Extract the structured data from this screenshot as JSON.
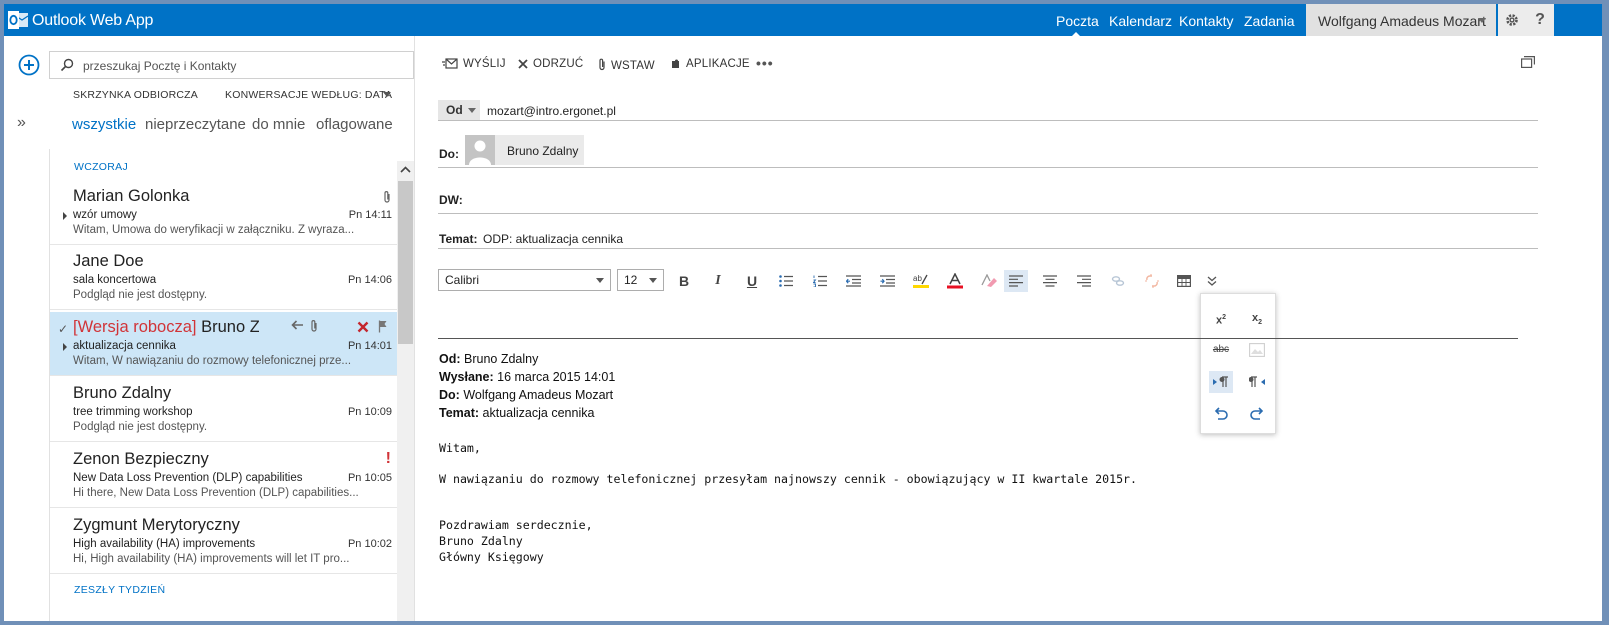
{
  "app": {
    "title": "Outlook Web App"
  },
  "nav": {
    "items": [
      "Poczta",
      "Kalendarz",
      "Kontakty",
      "Zadania"
    ],
    "user": "Wolfgang Amadeus Mozart",
    "help": "?"
  },
  "search": {
    "placeholder": "przeszukaj Pocztę i Kontakty"
  },
  "folder": {
    "name": "SKRZYNKA ODBIORCZA",
    "sort": "KONWERSACJE WEDŁUG: DATA"
  },
  "filters": [
    "wszystkie",
    "nieprzeczytane",
    "do mnie",
    "oflagowane"
  ],
  "groups": {
    "yesterday": "WCZORAJ",
    "last_week": "ZESZŁY TYDZIEŃ"
  },
  "messages": [
    {
      "sender": "Marian Golonka",
      "subject": "wzór umowy",
      "time": "Pn 14:11",
      "preview": "Witam, Umowa do weryfikacji w załączniku. Z wyraza..."
    },
    {
      "sender": "Jane Doe",
      "subject": "sala koncertowa",
      "time": "Pn 14:06",
      "preview": "Podgląd nie jest dostępny."
    },
    {
      "draft_tag": "[Wersja robocza]",
      "sender": "Bruno Zdalny",
      "subject": "aktualizacja cennika",
      "time": "Pn 14:01",
      "preview": "Witam, W nawiązaniu do rozmowy telefonicznej prze..."
    },
    {
      "sender": "Bruno Zdalny",
      "subject": "tree trimming workshop",
      "time": "Pn 10:09",
      "preview": "Podgląd nie jest dostępny."
    },
    {
      "sender": "Zenon Bezpieczny",
      "subject": "New Data Loss Prevention (DLP) capabilities",
      "time": "Pn 10:05",
      "preview": "Hi there, New Data Loss Prevention (DLP) capabilities..."
    },
    {
      "sender": "Zygmunt Merytoryczny",
      "subject": "High availability (HA) improvements",
      "time": "Pn 10:02",
      "preview": "Hi, High availability (HA) improvements will let IT pro..."
    }
  ],
  "toolbar": {
    "send": "WYŚLIJ",
    "discard": "ODRZUĆ",
    "insert": "WSTAW",
    "apps": "APLIKACJE",
    "more": "•••"
  },
  "compose": {
    "from_label": "Od",
    "from_addr": "mozart@intro.ergonet.pl",
    "to_label": "Do:",
    "to_name": "Bruno Zdalny",
    "cc_label": "DW:",
    "subject_label": "Temat:",
    "subject": "ODP: aktualizacja cennika",
    "font": "Calibri",
    "size": "12"
  },
  "quoted": {
    "from_label": "Od:",
    "from": "Bruno Zdalny",
    "sent_label": "Wysłane:",
    "sent": "16 marca 2015 14:01",
    "to_label": "Do:",
    "to": "Wolfgang Amadeus Mozart",
    "subject_label": "Temat:",
    "subject": "aktualizacja cennika"
  },
  "body": {
    "greeting": "Witam,",
    "text": "W nawiązaniu do rozmowy telefonicznej przesyłam najnowszy cennik - obowiązujący w II kwartale 2015r.",
    "closing": "Pozdrawiam serdecznie,",
    "sig_name": "Bruno Zdalny",
    "sig_title": "Główny Księgowy"
  },
  "colors": {
    "brand": "#0072c6",
    "draft": "#d13438",
    "selected": "#cde6f7"
  }
}
